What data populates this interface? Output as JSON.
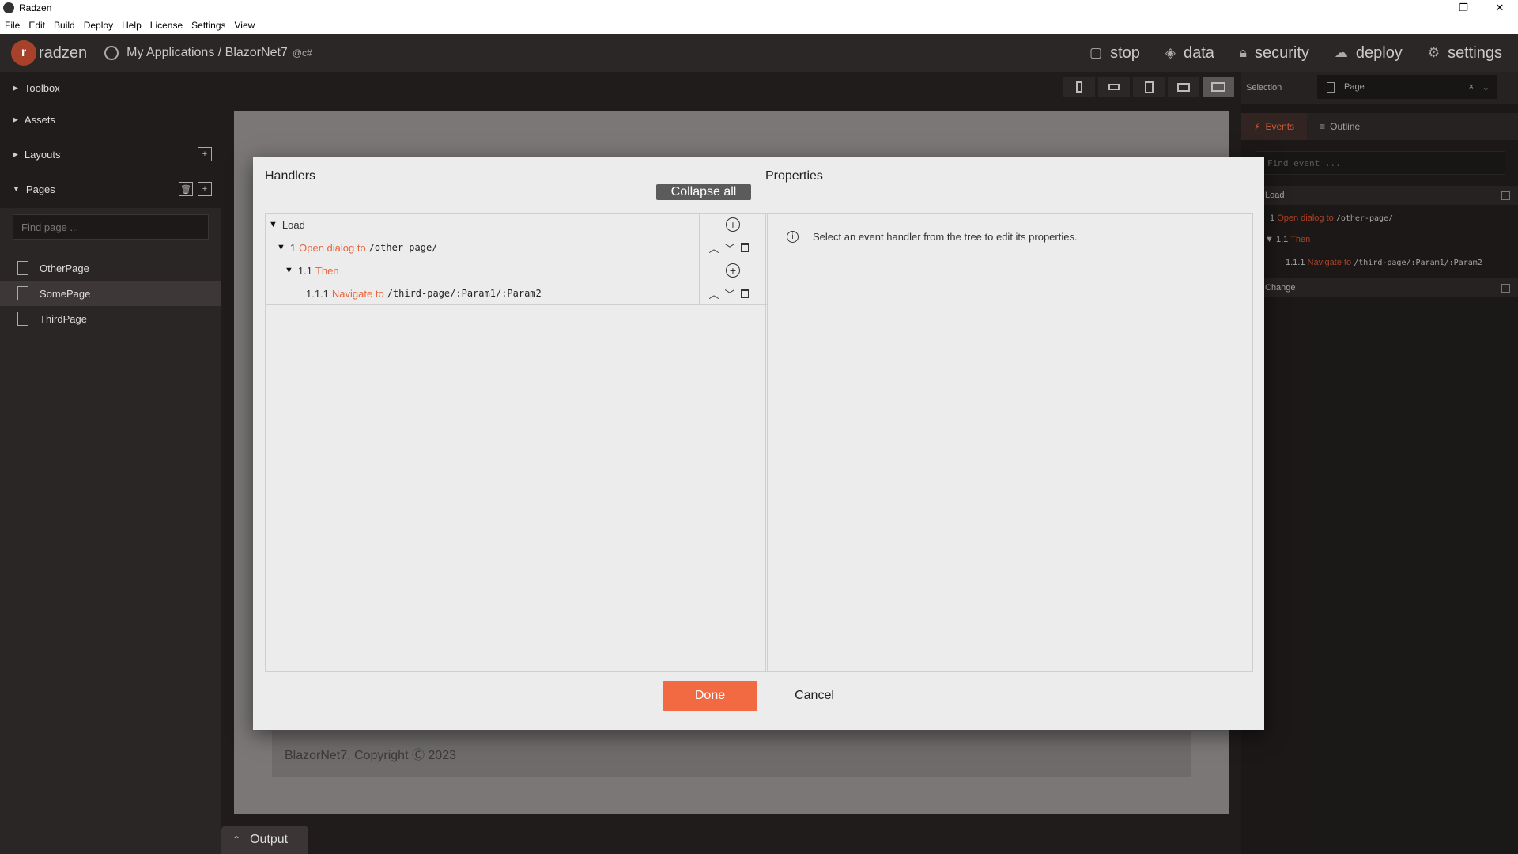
{
  "window": {
    "title": "Radzen",
    "minimize": "—",
    "restore": "❐",
    "close": "✕"
  },
  "menu": [
    "File",
    "Edit",
    "Build",
    "Deploy",
    "Help",
    "License",
    "Settings",
    "View"
  ],
  "header": {
    "logo_text": "radzen",
    "breadcrumb": "My Applications / BlazorNet7",
    "breadcrumb_tag": "@c#",
    "nav": [
      {
        "label": "stop",
        "icon": "stop-icon"
      },
      {
        "label": "data",
        "icon": "layers-icon"
      },
      {
        "label": "security",
        "icon": "lock-icon"
      },
      {
        "label": "deploy",
        "icon": "cloud-upload-icon"
      },
      {
        "label": "settings",
        "icon": "gear-icon"
      }
    ]
  },
  "sidebar": {
    "sections": [
      "Toolbox",
      "Assets",
      "Layouts",
      "Pages"
    ],
    "find_page_placeholder": "Find page ...",
    "pages": [
      "OtherPage",
      "SomePage",
      "ThirdPage"
    ],
    "active_page": "SomePage"
  },
  "canvas": {
    "footer_text": "BlazorNet7, Copyright Ⓒ 2023",
    "output_label": "Output"
  },
  "right_panel": {
    "selection_label": "Selection",
    "selection_value": "Page",
    "tabs": [
      "Events",
      "Outline"
    ],
    "active_tab": "Events",
    "find_event_placeholder": "Find event ...",
    "events": [
      {
        "name": "Load"
      },
      {
        "name": "Change"
      }
    ],
    "tree": {
      "l1_num": "1",
      "l1_action": "Open dialog to",
      "l1_target": "/other-page/",
      "l2_num": "1.1",
      "l2_action": "Then",
      "l3_num": "1.1.1",
      "l3_action": "Navigate to",
      "l3_target": "/third-page/:Param1/:Param2"
    }
  },
  "dialog": {
    "handlers_title": "Handlers",
    "collapse_all": "Collapse all",
    "properties_title": "Properties",
    "rows": {
      "event": "Load",
      "r1_num": "1",
      "r1_action": "Open dialog to",
      "r1_target": "/other-page/",
      "r2_num": "1.1",
      "r2_action": "Then",
      "r3_num": "1.1.1",
      "r3_action": "Navigate to",
      "r3_target": "/third-page/:Param1/:Param2"
    },
    "properties_message": "Select an event handler from the tree to edit its properties.",
    "done": "Done",
    "cancel": "Cancel"
  },
  "colors": {
    "accent": "#f26a41",
    "dark_bg": "#1f1c1b",
    "dialog_bg": "#ececec"
  }
}
